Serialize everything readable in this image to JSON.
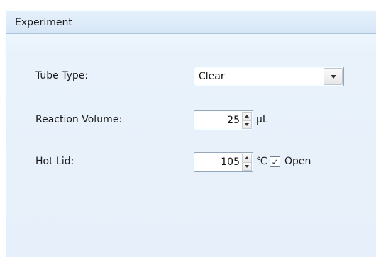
{
  "panel": {
    "title": "Experiment"
  },
  "tube_type": {
    "label": "Tube Type:",
    "selected": "Clear"
  },
  "reaction_volume": {
    "label": "Reaction Volume:",
    "value": "25",
    "unit": "μL"
  },
  "hot_lid": {
    "label": "Hot Lid:",
    "value": "105",
    "unit": "℃",
    "open_checked": true,
    "open_label": "Open",
    "check_glyph": "✓"
  },
  "icons": {
    "dropdown": "chevron-down-icon",
    "spin_up": "spin-up-icon",
    "spin_down": "spin-down-icon"
  }
}
